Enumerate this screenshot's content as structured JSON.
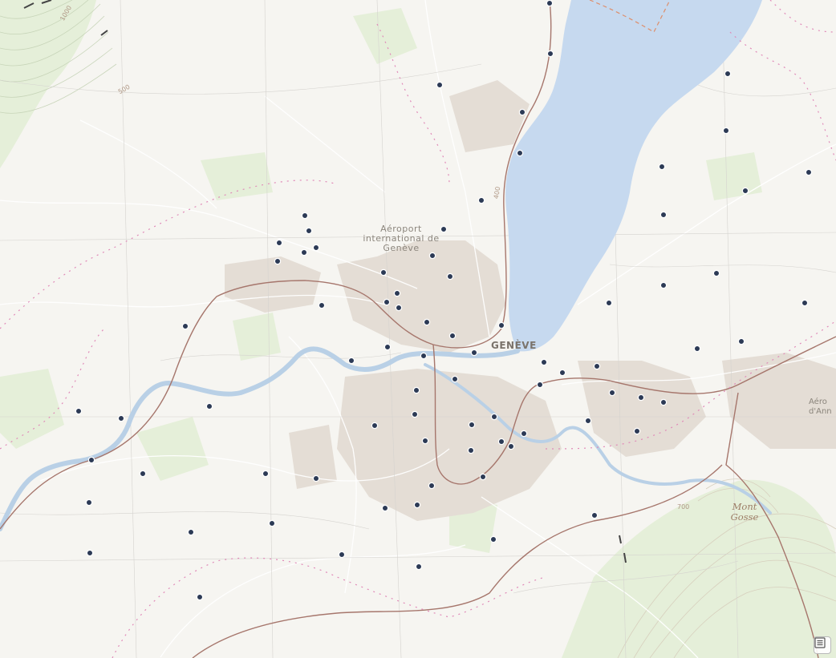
{
  "map": {
    "labels": {
      "airport": "Aéroport\ninternational de\nGenève",
      "city": "GENÈVE",
      "mountain": "Mont\nGosse",
      "airport_annecy": "Aéro\nd'Ann"
    },
    "contours": {
      "c500": "500",
      "c1000": "1000",
      "c700": "700",
      "c400": "400"
    },
    "colors": {
      "water": "#c6d9ef",
      "land": "#f6f5f1",
      "urban": "#e0d8d0",
      "green": "#e3eed6",
      "marker_fill": "#2c3a55",
      "marker_stroke": "#ffffff",
      "rail": "#a6766c",
      "border": "#e08ab8"
    },
    "marker_symbol": "point-marker",
    "legend_button_icon": "legend-icon"
  }
}
